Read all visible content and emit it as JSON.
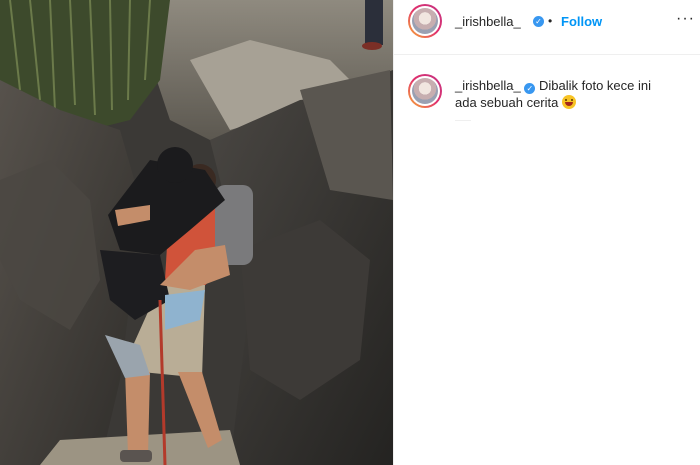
{
  "post": {
    "username": "_irishbella_",
    "separator": "•",
    "follow_label": "Follow",
    "more_label": "···",
    "caption_text": "Dibalik foto kece ini ada sebuah cerita",
    "caption_emoji": "grinning-squinting-face",
    "verified_glyph": "✓"
  },
  "colors": {
    "follow_blue": "#0095f6",
    "verified_blue": "#3897f0",
    "text": "#262626",
    "divider": "#efefef"
  },
  "icons": [
    "verified-badge-icon",
    "more-options-icon",
    "emoji-icon"
  ]
}
